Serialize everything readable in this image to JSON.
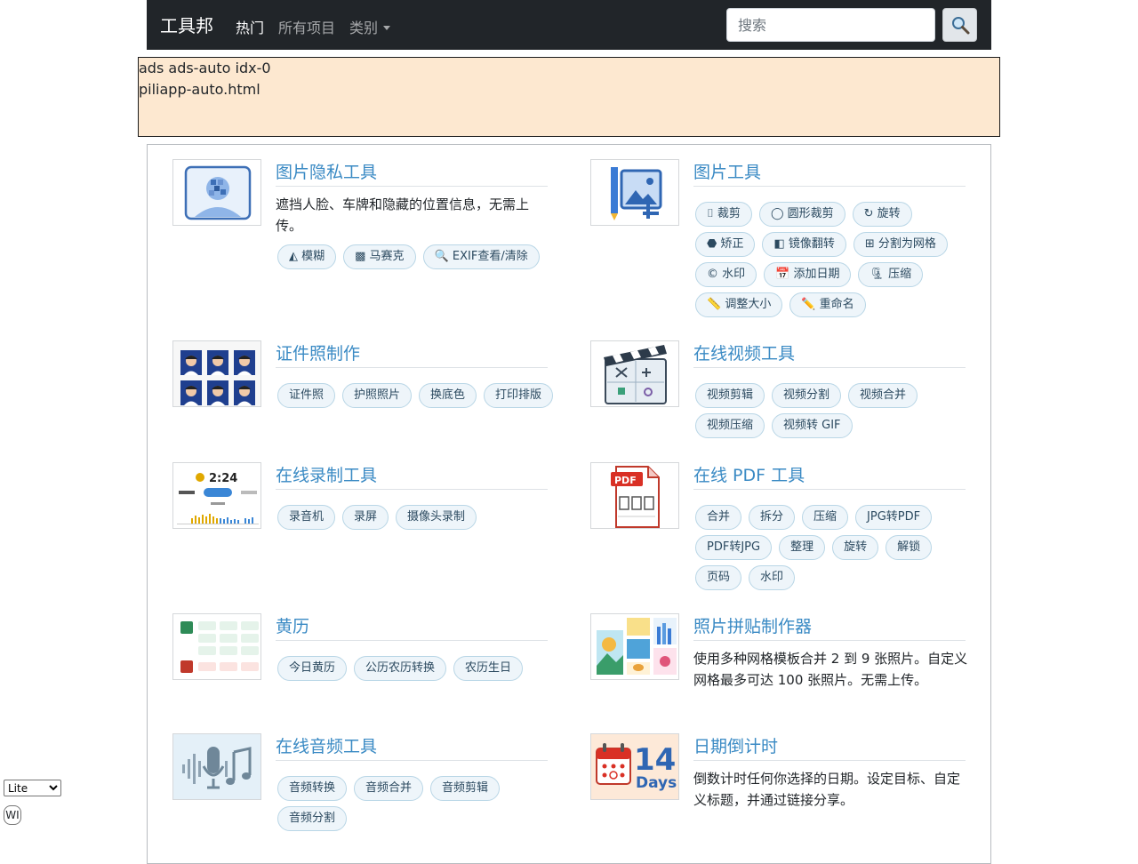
{
  "navbar": {
    "brand": "工具邦",
    "links": [
      "热门",
      "所有项目",
      "类别"
    ],
    "search_placeholder": "搜索"
  },
  "ads": {
    "line1": "ads ads-auto idx-0",
    "line2": "piliapp-auto.html"
  },
  "tools": {
    "image_privacy": {
      "title": "图片隐私工具",
      "desc": "遮挡人脸、车牌和隐藏的位置信息，无需上传。",
      "tags": [
        "◭ 模糊",
        "▩ 马赛克",
        "🔍 EXIF查看/清除"
      ]
    },
    "image_tools": {
      "title": "图片工具",
      "tags": [
        "⌷ 裁剪",
        "◯ 圆形裁剪",
        "↻ 旋转",
        "⬣ 矫正",
        "◧ 镜像翻转",
        "⊞ 分割为网格",
        "© 水印",
        "📅 添加日期",
        "🗜 压缩",
        "📏 调整大小",
        "✏️ 重命名"
      ]
    },
    "id_photo": {
      "title": "证件照制作",
      "tags": [
        "证件照",
        "护照照片",
        "换底色",
        "打印排版"
      ]
    },
    "video_tools": {
      "title": "在线视频工具",
      "tags": [
        "视频剪辑",
        "视频分割",
        "视频合并",
        "视频压缩",
        "视频转 GIF"
      ]
    },
    "recording": {
      "title": "在线录制工具",
      "tags": [
        "录音机",
        "录屏",
        "摄像头录制"
      ],
      "thumb_time": "2:24"
    },
    "pdf_tools": {
      "title": "在线 PDF 工具",
      "tags": [
        "合并",
        "拆分",
        "压缩",
        "JPG转PDF",
        "PDF转JPG",
        "整理",
        "旋转",
        "解锁",
        "页码",
        "水印"
      ],
      "thumb_label": "PDF"
    },
    "almanac": {
      "title": "黄历",
      "tags": [
        "今日黄历",
        "公历农历转换",
        "农历生日"
      ]
    },
    "collage": {
      "title": "照片拼贴制作器",
      "desc": "使用多种网格模板合并 2 到 9 张照片。自定义网格最多可达 100 张照片。无需上传。"
    },
    "audio_tools": {
      "title": "在线音频工具",
      "tags": [
        "音频转换",
        "音频合并",
        "音频剪辑",
        "音频分割"
      ]
    },
    "countdown": {
      "title": "日期倒计时",
      "desc": "倒数计时任何你选择的日期。设定目标、自定义标题，并通过链接分享。",
      "thumb_num": "14",
      "thumb_unit": "Days"
    }
  },
  "footer": {
    "mode_select": "Lite",
    "wi_label": "WI"
  }
}
